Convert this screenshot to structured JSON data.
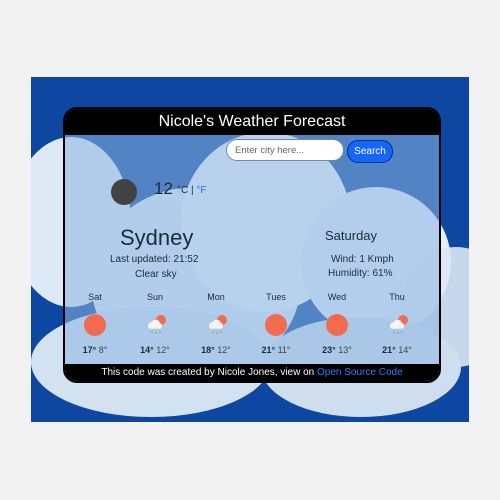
{
  "app": {
    "title": "Nicole's Weather Forecast"
  },
  "search": {
    "placeholder": "Enter city here...",
    "button_label": "Search"
  },
  "current": {
    "temperature": "12",
    "unit_c": "°C",
    "separator": "|",
    "unit_f": "°F",
    "icon": "dark-moon-icon",
    "city": "Sydney",
    "last_updated": "Last updated: 21:52",
    "description": "Clear sky",
    "day": "Saturday",
    "wind": "Wind: 1 Kmph",
    "humidity": "Humidity: 61%"
  },
  "forecast": [
    {
      "day": "Sat",
      "icon": "sun-icon",
      "high": "17°",
      "low": "8°"
    },
    {
      "day": "Sun",
      "icon": "snow-cloud-icon",
      "high": "14°",
      "low": "12°"
    },
    {
      "day": "Mon",
      "icon": "snow-cloud-icon",
      "high": "18°",
      "low": "12°"
    },
    {
      "day": "Tues",
      "icon": "sun-icon",
      "high": "21°",
      "low": "11°"
    },
    {
      "day": "Wed",
      "icon": "sun-icon",
      "high": "23°",
      "low": "13°"
    },
    {
      "day": "Thu",
      "icon": "snow-cloud-icon",
      "high": "21°",
      "low": "14°"
    }
  ],
  "footer": {
    "text": "This code was created by Nicole Jones, view on ",
    "link_label": "Open Source Code"
  },
  "colors": {
    "page_background": "#0d47a1",
    "button": "#1565ff",
    "sun": "#f26b50"
  }
}
